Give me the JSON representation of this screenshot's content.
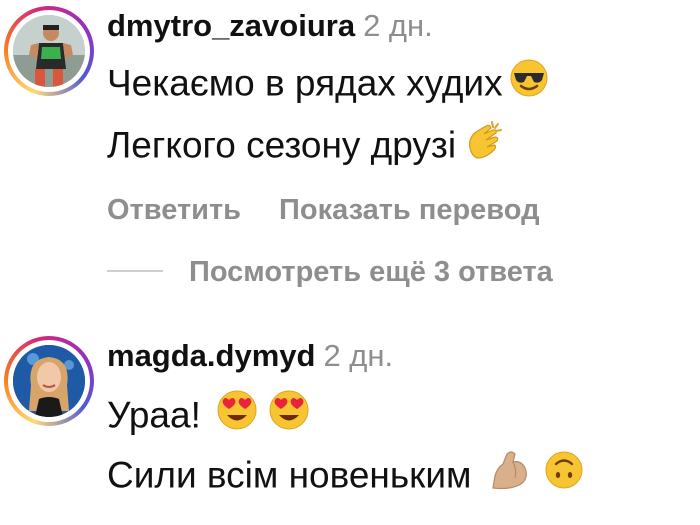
{
  "comments": [
    {
      "username": "dmytro_zavoiura",
      "time": "2 дн.",
      "lines": [
        {
          "text": "Чекаємо в рядах худих",
          "emoji": "smiling-face-sunglasses-icon"
        },
        {
          "text": "Легкого сезону друзі",
          "emoji": "clapping-hands-icon"
        }
      ],
      "actions": {
        "reply": "Ответить",
        "translate": "Показать перевод"
      },
      "view_replies": "Посмотреть ещё 3 ответа"
    },
    {
      "username": "magda.dymyd",
      "time": "2 дн.",
      "lines": [
        {
          "text": "Ураа!",
          "emoji": "heart-eyes-icon"
        },
        {
          "text": "Сили всім новеньким",
          "emoji": "flexed-biceps-icon"
        }
      ]
    }
  ],
  "colors": {
    "secondary_text": "#8e8e8e",
    "primary_text": "#111111"
  }
}
